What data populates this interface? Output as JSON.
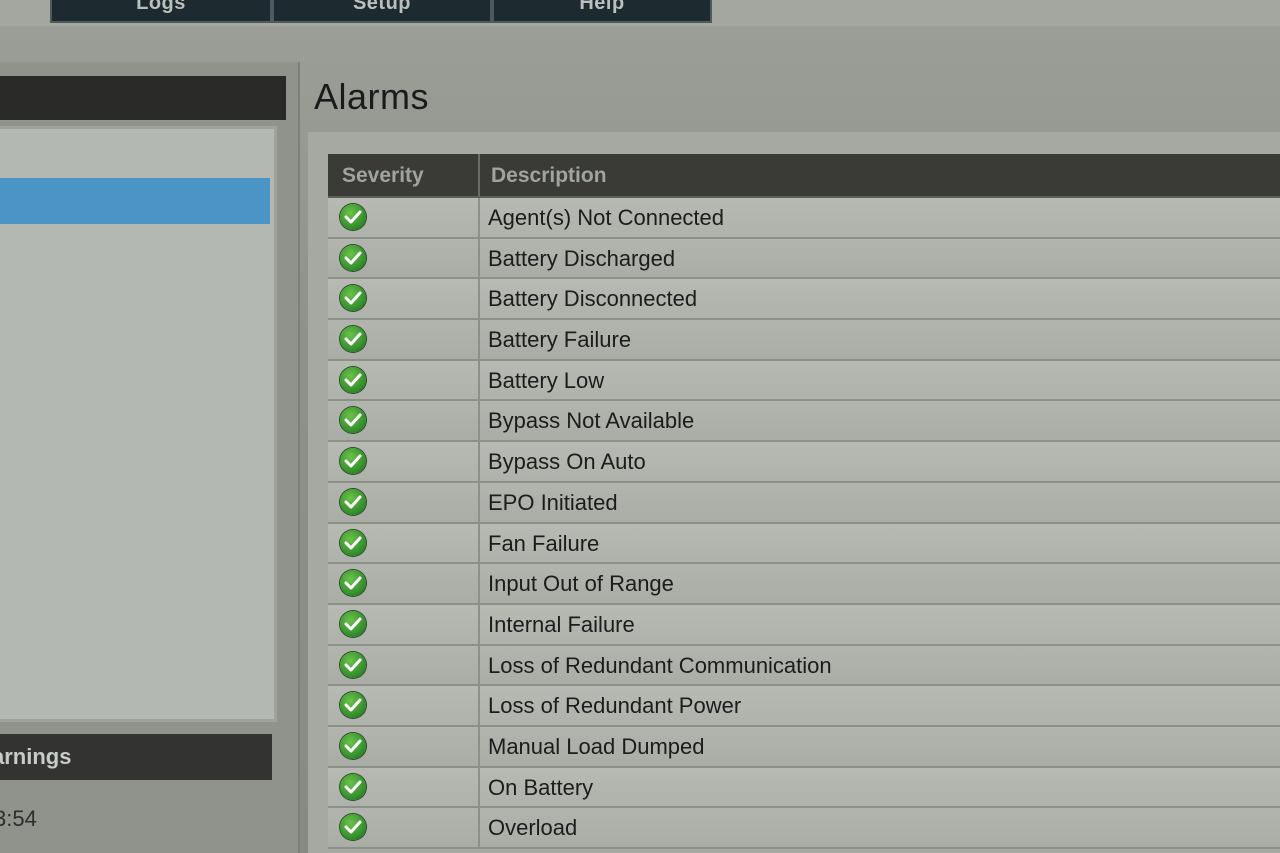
{
  "nav": {
    "tabs": [
      {
        "label": "Logs"
      },
      {
        "label": "Setup"
      },
      {
        "label": "Help"
      }
    ]
  },
  "sidebar": {
    "warnings_label": "arnings",
    "time_text": "3:54"
  },
  "main": {
    "title": "Alarms",
    "table": {
      "columns": [
        "Severity",
        "Description"
      ],
      "rows": [
        {
          "severity_icon": "check-circle-icon",
          "description": "Agent(s) Not Connected"
        },
        {
          "severity_icon": "check-circle-icon",
          "description": "Battery Discharged"
        },
        {
          "severity_icon": "check-circle-icon",
          "description": "Battery Disconnected"
        },
        {
          "severity_icon": "check-circle-icon",
          "description": "Battery Failure"
        },
        {
          "severity_icon": "check-circle-icon",
          "description": "Battery Low"
        },
        {
          "severity_icon": "check-circle-icon",
          "description": "Bypass Not Available"
        },
        {
          "severity_icon": "check-circle-icon",
          "description": "Bypass On Auto"
        },
        {
          "severity_icon": "check-circle-icon",
          "description": "EPO Initiated"
        },
        {
          "severity_icon": "check-circle-icon",
          "description": "Fan Failure"
        },
        {
          "severity_icon": "check-circle-icon",
          "description": "Input Out of Range"
        },
        {
          "severity_icon": "check-circle-icon",
          "description": "Internal Failure"
        },
        {
          "severity_icon": "check-circle-icon",
          "description": "Loss of Redundant Communication"
        },
        {
          "severity_icon": "check-circle-icon",
          "description": "Loss of Redundant Power"
        },
        {
          "severity_icon": "check-circle-icon",
          "description": "Manual Load Dumped"
        },
        {
          "severity_icon": "check-circle-icon",
          "description": "On Battery"
        },
        {
          "severity_icon": "check-circle-icon",
          "description": "Overload"
        }
      ]
    }
  },
  "colors": {
    "ok_green": "#3a9a30",
    "header_dark": "#3a3b37",
    "selection_blue": "#4b95c6"
  }
}
